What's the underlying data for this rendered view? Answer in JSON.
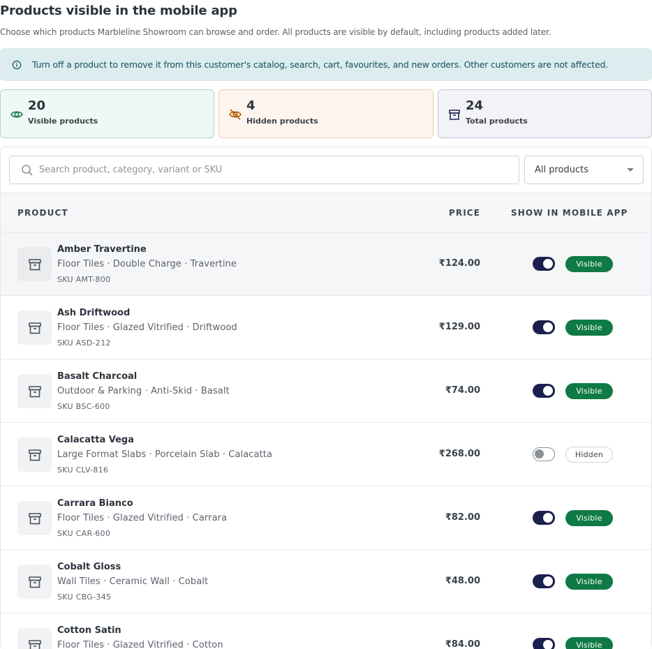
{
  "page": {
    "title": "Products visible in the mobile app",
    "subtitle": "Choose which products Marbleline Showroom can browse and order. All products are visible by default, including products added later."
  },
  "banner": {
    "text": "Turn off a product to remove it from this customer's catalog, search, cart, favourites, and new orders. Other customers are not affected.",
    "icon": "info-icon"
  },
  "stats": {
    "visible": {
      "value": "20",
      "label": "Visible products",
      "icon": "eye-icon",
      "color": "#0f7a45"
    },
    "hidden": {
      "value": "4",
      "label": "Hidden products",
      "icon": "eye-off-icon",
      "color": "#b35a00"
    },
    "total": {
      "value": "24",
      "label": "Total products",
      "icon": "archive-box-icon",
      "color": "#1a1f4e"
    }
  },
  "search": {
    "placeholder": "Search product, category, variant or SKU"
  },
  "filter": {
    "selected": "All products"
  },
  "table": {
    "headers": {
      "product": "PRODUCT",
      "price": "PRICE",
      "show": "SHOW IN MOBILE APP"
    },
    "rows": [
      {
        "name": "Amber Travertine",
        "meta": "Floor Tiles · Double Charge · Travertine",
        "sku": "SKU AMT-800",
        "price": "₹124.00",
        "enabled": true,
        "status": "Visible"
      },
      {
        "name": "Ash Driftwood",
        "meta": "Floor Tiles · Glazed Vitrified · Driftwood",
        "sku": "SKU ASD-212",
        "price": "₹129.00",
        "enabled": true,
        "status": "Visible"
      },
      {
        "name": "Basalt Charcoal",
        "meta": "Outdoor & Parking · Anti-Skid · Basalt",
        "sku": "SKU BSC-600",
        "price": "₹74.00",
        "enabled": true,
        "status": "Visible"
      },
      {
        "name": "Calacatta Vega",
        "meta": "Large Format Slabs · Porcelain Slab · Calacatta",
        "sku": "SKU CLV-816",
        "price": "₹268.00",
        "enabled": false,
        "status": "Hidden"
      },
      {
        "name": "Carrara Bianco",
        "meta": "Floor Tiles · Glazed Vitrified · Carrara",
        "sku": "SKU CAR-600",
        "price": "₹82.00",
        "enabled": true,
        "status": "Visible"
      },
      {
        "name": "Cobalt Gloss",
        "meta": "Wall Tiles · Ceramic Wall · Cobalt",
        "sku": "SKU CBG-345",
        "price": "₹48.00",
        "enabled": true,
        "status": "Visible"
      },
      {
        "name": "Cotton Satin",
        "meta": "Floor Tiles · Glazed Vitrified · Cotton",
        "sku": "",
        "price": "₹84.00",
        "enabled": true,
        "status": "Visible"
      }
    ]
  }
}
